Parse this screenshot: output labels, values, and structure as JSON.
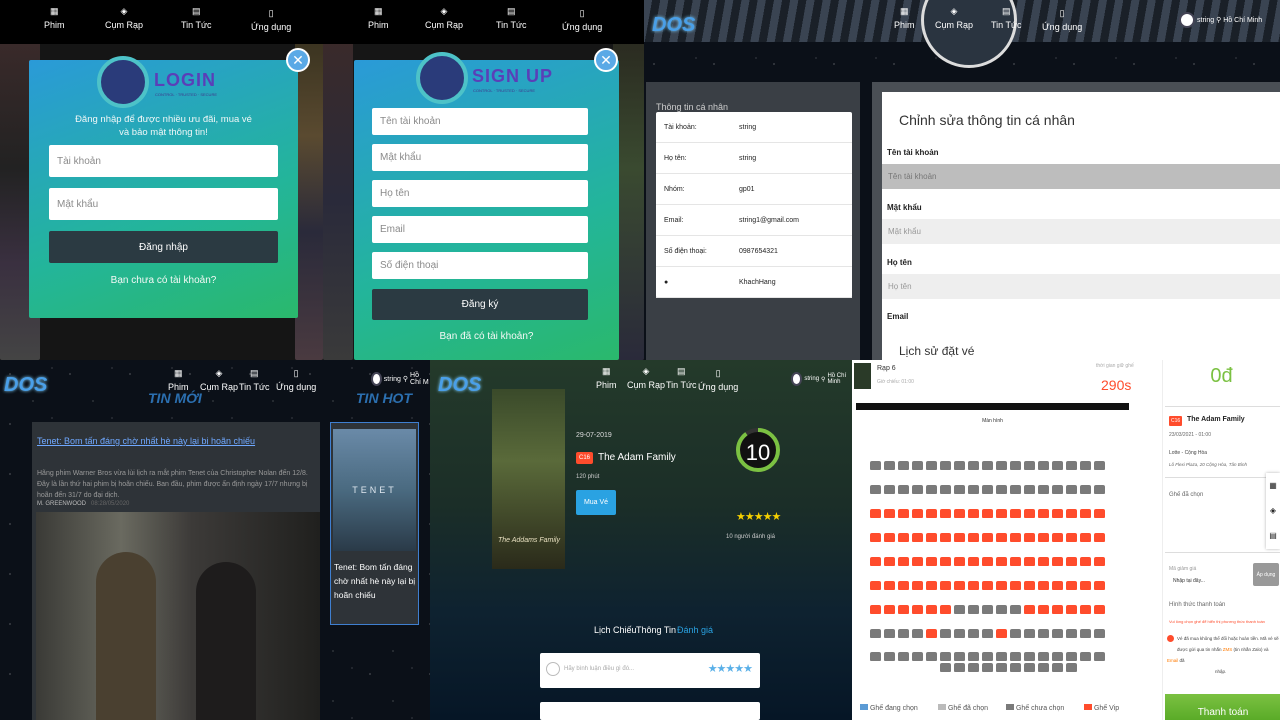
{
  "nav": {
    "phim": "Phim",
    "cumrap": "Cụm Rạp",
    "tintuc": "Tin Tức",
    "ungdung": "Ứng dụng"
  },
  "login": {
    "logo": "LOGIN",
    "logo_sub": "CONTROL · TRUSTED · SECURE",
    "desc1": "Đăng nhập để được nhiều ưu đãi, mua vé",
    "desc2": "và bảo mật thông tin!",
    "username_ph": "Tài khoản",
    "password_ph": "Mật khẩu",
    "submit": "Đăng nhập",
    "register_link": "Bạn chưa có tài khoản?"
  },
  "signup": {
    "logo": "SIGN UP",
    "logo_sub": "CONTROL · TRUSTED · SECURE",
    "username_ph": "Tên tài khoản",
    "password_ph": "Mật khẩu",
    "fullname_ph": "Họ tên",
    "email_ph": "Email",
    "phone_ph": "Số điện thoại",
    "submit": "Đăng ký",
    "login_link": "Bạn đã có tài khoản?"
  },
  "profile": {
    "user": "string",
    "location": "Hồ Chí Minh",
    "brand": "DOS",
    "info_title": "Thông tin cá nhân",
    "rows": [
      {
        "k": "Tài khoản:",
        "v": "string"
      },
      {
        "k": "Họ tên:",
        "v": "string"
      },
      {
        "k": "Nhóm:",
        "v": "gp01"
      },
      {
        "k": "Email:",
        "v": "string1@gmail.com"
      },
      {
        "k": "Số điện thoại:",
        "v": "0987654321"
      },
      {
        "k": "",
        "v": "KhachHang"
      }
    ],
    "edit_title": "Chỉnh sửa thông tin cá nhân",
    "f_username": "Tên tài khoản",
    "f_username_ph": "Tên tài khoản",
    "f_password": "Mật khẩu",
    "f_password_ph": "Mật khẩu",
    "f_fullname": "Họ tên",
    "f_fullname_ph": "Họ tên",
    "f_email": "Email",
    "history_title": "Lịch sử đặt vé"
  },
  "news": {
    "tinmoi": "TIN MỚI",
    "tinhot": "TIN HOT",
    "user": "string",
    "location": "Hồ Chí M",
    "headline": "Tenet: Bom tấn đáng chờ nhất hè này lại bị hoãn chiếu",
    "body": "Hãng phim Warner Bros vừa lùi lịch ra mắt phim Tenet của Christopher Nolan đến 12/8. Đây là lần thứ hai phim bị hoãn chiếu. Ban đầu, phim được ấn định ngày 17/7 nhưng bị hoãn đến 31/7 do đại dịch.",
    "author": "M. GREENWOOD",
    "date": "08:28/05/2020",
    "hot_title": "Tenet: Bom tấn đáng chờ nhất hè này lại bị hoãn chiếu",
    "hot_img_text": "TENET"
  },
  "movie": {
    "user": "string",
    "location": "Hồ Chí Minh",
    "date": "29-07-2019",
    "rating_badge": "C16",
    "title": "The Adam Family",
    "duration": "120 phút",
    "buy": "Mua Vé",
    "score": "10",
    "stars": "★★★★★",
    "votes": "10 người đánh giá",
    "tab1": "Lịch Chiếu",
    "tab2": "Thông Tin",
    "tab3": "Đánh giá",
    "review_ph": "Hãy bình luận điều gì đó...",
    "poster_title": "The Addams Family"
  },
  "booking": {
    "cinema": "Rạp 6",
    "showtime": "Giờ chiếu: 01:00",
    "timer_label": "thời gian giữ ghế",
    "timer": "290s",
    "screen": "Màn hình",
    "price": "0đ",
    "badge": "C16",
    "movie": "The Adam Family",
    "datetime": "23/03/2021 - 01:00",
    "cinema_name": "Lotte - Cộng Hòa",
    "address": "Lô Flexi Plaza, 20 Cộng Hòa, Tân Bình",
    "seat_label": "Ghế đã chọn",
    "discount_label": "Mã giảm giá",
    "discount_ph": "Nhập tại đây...",
    "apply": "Áp dụng",
    "payment_label": "Hình thức thanh toán",
    "payment_warning": "Vui lòng chọn ghế để hiển thị phương thức thanh toán",
    "notice_a": "Vé đã mua không thể đổi hoặc hoàn tiền. Mã vé sẽ",
    "notice_b": "được gửi qua tin nhắn ",
    "notice_zms": "ZMS",
    "notice_c": " (tin nhắn Zalo) và ",
    "notice_email": "Email",
    "notice_d": " đã",
    "notice_e": "nhập.",
    "pay": "Thanh toán",
    "legend1": "Ghế đang chọn",
    "legend2": "Ghế đã chọn",
    "legend3": "Ghế chưa chọn",
    "legend4": "Ghế Vip"
  },
  "colors": {
    "accent": "#2aa2e2",
    "red": "#ff4c2c",
    "green": "#36c06a"
  }
}
